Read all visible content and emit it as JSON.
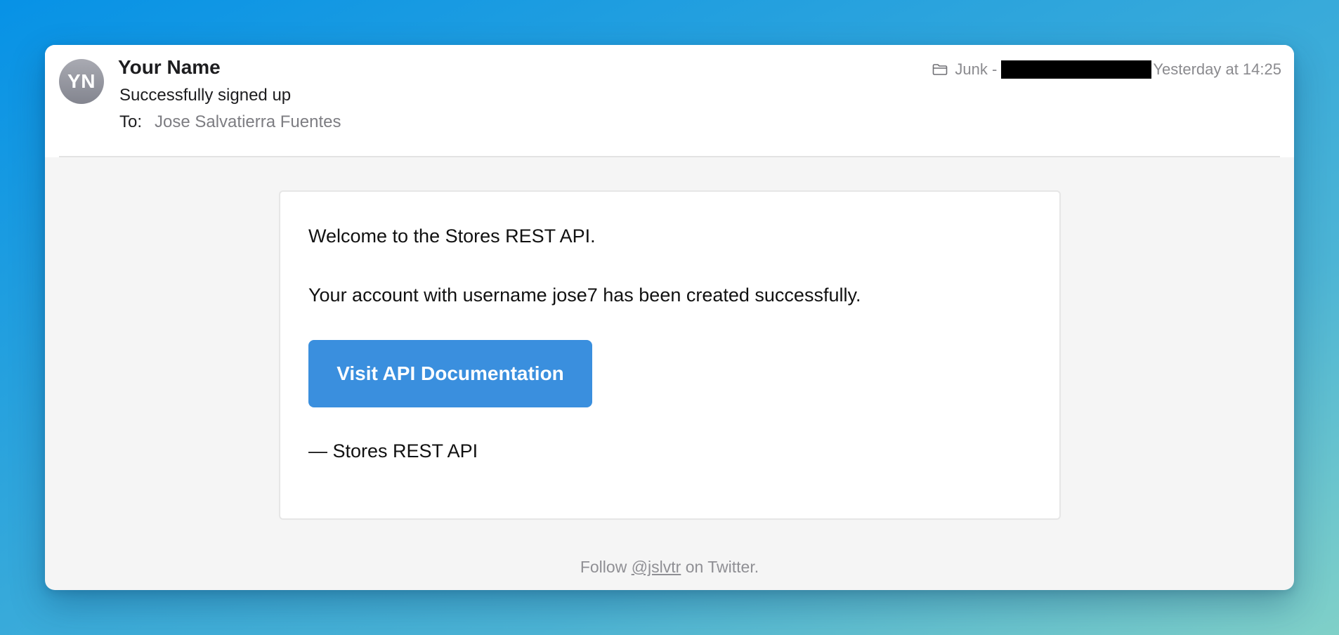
{
  "header": {
    "avatar_initials": "YN",
    "sender_name": "Your Name",
    "subject": "Successfully signed up",
    "to_label": "To:",
    "to_value": "Jose Salvatierra Fuentes",
    "folder_icon": "folder-icon",
    "folder": "Junk -",
    "timestamp": "Yesterday at 14:25"
  },
  "body": {
    "line1": "Welcome to the Stores REST API.",
    "line2": "Your account with username jose7 has been created successfully.",
    "button_label": "Visit API Documentation",
    "signature": "— Stores REST API"
  },
  "footer": {
    "prefix": "Follow",
    "handle": "@jslvtr",
    "suffix": "on Twitter."
  },
  "colors": {
    "button": "#3a8fde",
    "avatar": "#8f9099"
  }
}
